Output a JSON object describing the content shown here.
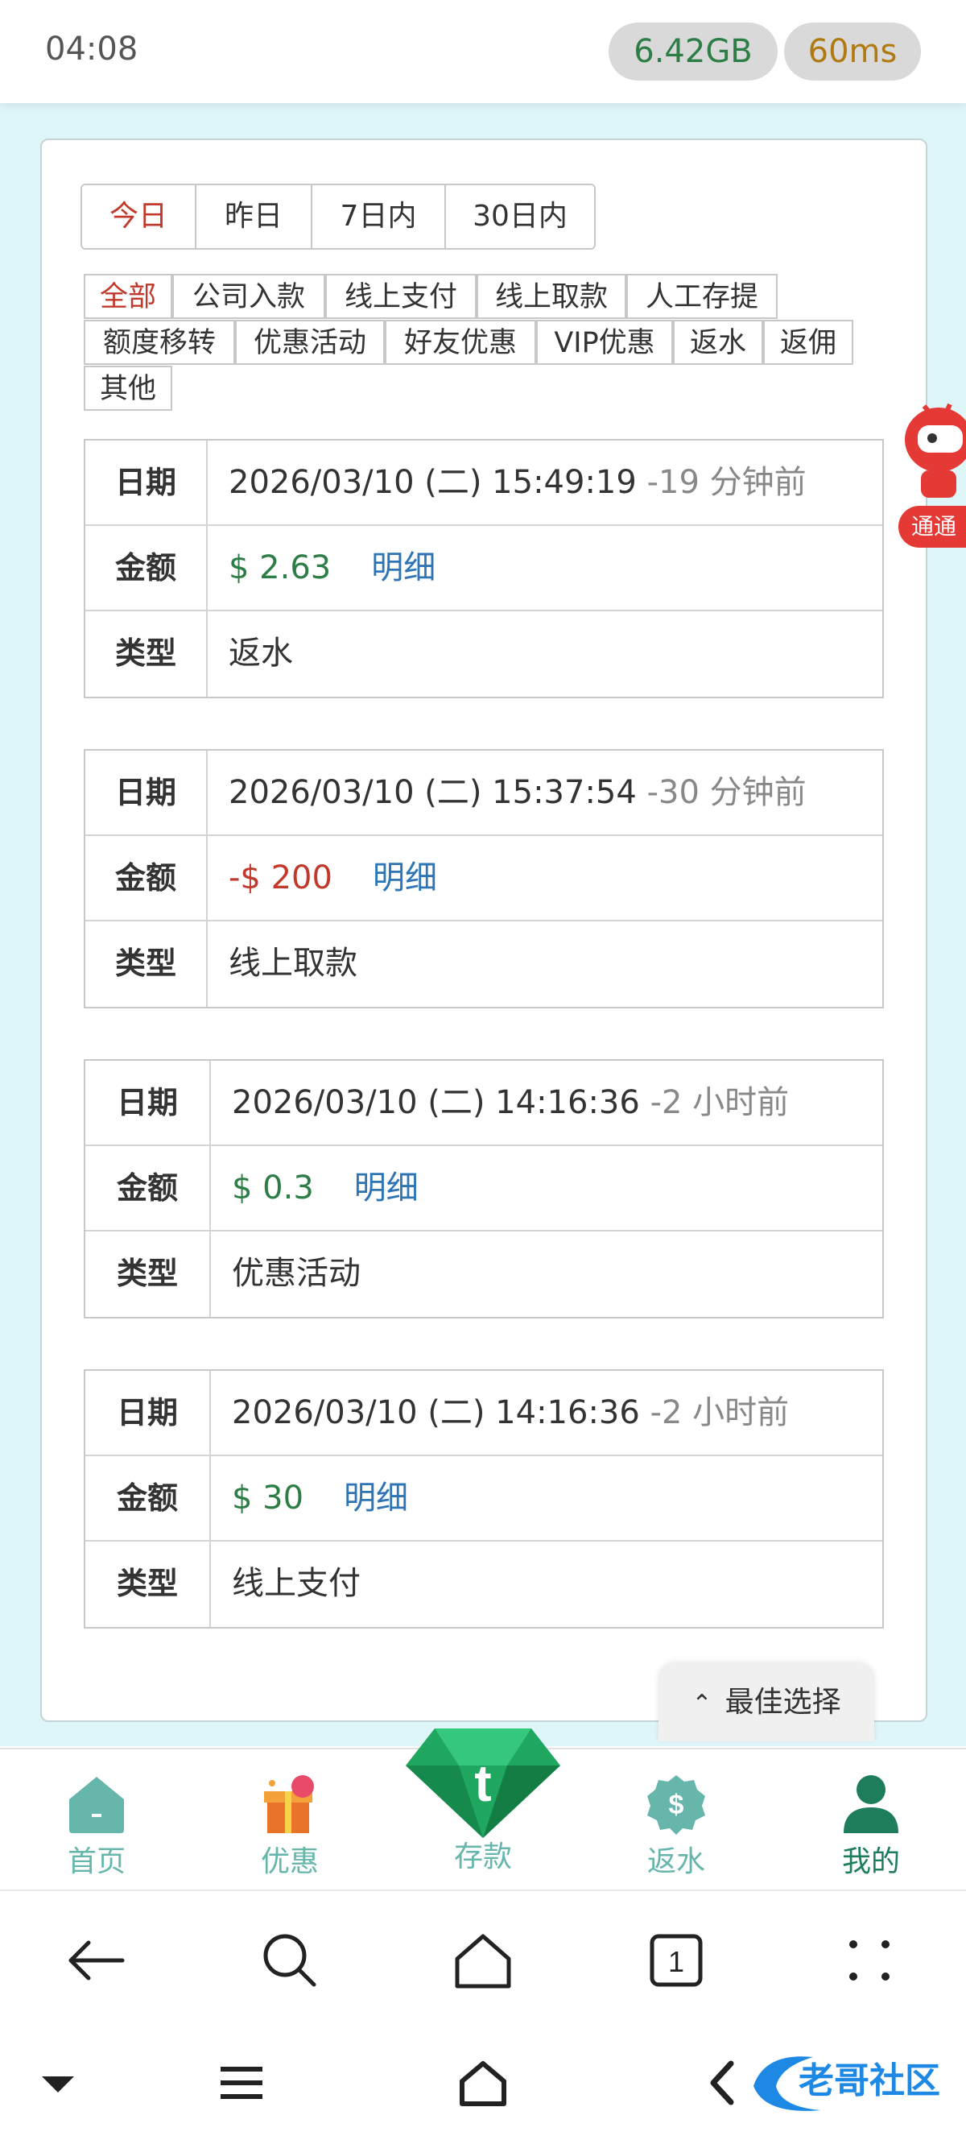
{
  "status_bar": {
    "time": "04:08",
    "memory": "6.42GB",
    "ping": "60ms"
  },
  "date_filters": [
    "今日",
    "昨日",
    "7日内",
    "30日内"
  ],
  "category_filters": [
    "全部",
    "公司入款",
    "线上支付",
    "线上取款",
    "人工存提",
    "额度移转",
    "优惠活动",
    "好友优惠",
    "VIP优惠",
    "返水",
    "返佣",
    "其他"
  ],
  "labels": {
    "date": "日期",
    "amount": "金额",
    "type": "类型",
    "detail": "明细"
  },
  "records": [
    {
      "date": "2026/03/10 (二) 15:49:19",
      "ago": "-19 分钟前",
      "amount": "$ 2.63",
      "type": "返水"
    },
    {
      "date": "2026/03/10 (二) 15:37:54",
      "ago": "-30 分钟前",
      "amount": "-$ 200",
      "type": "线上取款"
    },
    {
      "date": "2026/03/10 (二) 14:16:36",
      "ago": "-2 小时前",
      "amount": "$ 0.3",
      "type": "优惠活动"
    },
    {
      "date": "2026/03/10 (二) 14:16:36",
      "ago": "-2 小时前",
      "amount": "$ 30",
      "type": "线上支付"
    }
  ],
  "best_choice": "最佳选择",
  "robot_tag": "通通",
  "bottom_nav": [
    "首页",
    "优惠",
    "存款",
    "返水",
    "我的"
  ],
  "watermark": "老哥社区",
  "colors": {
    "accent_green": "#1e7d5a",
    "positive": "#2d7d46",
    "negative": "#c0392b",
    "link": "#2f75b5",
    "page_bg": "#dff6f8"
  }
}
